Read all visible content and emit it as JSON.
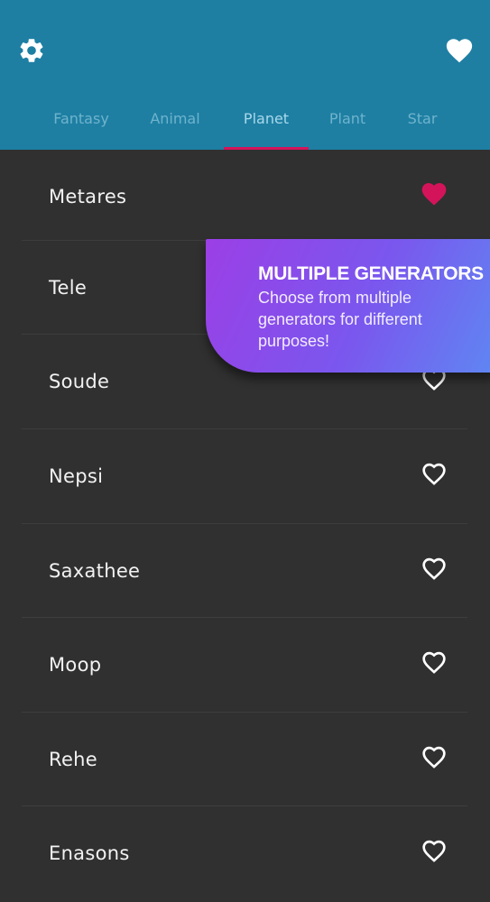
{
  "header": {
    "settings_icon": "gear-icon",
    "favorites_icon": "heart-filled-icon",
    "background_color": "#1e7fa3"
  },
  "tabs": [
    {
      "label": "Fantasy",
      "active": false
    },
    {
      "label": "Animal",
      "active": false
    },
    {
      "label": "Planet",
      "active": true
    },
    {
      "label": "Plant",
      "active": false
    },
    {
      "label": "Star",
      "active": false
    }
  ],
  "accent_color": "#d4145a",
  "names": [
    {
      "name": "Metares",
      "favorited": true
    },
    {
      "name": "Tele",
      "favorited": false
    },
    {
      "name": "Soude",
      "favorited": false
    },
    {
      "name": "Nepsi",
      "favorited": false
    },
    {
      "name": "Saxathee",
      "favorited": false
    },
    {
      "name": "Moop",
      "favorited": false
    },
    {
      "name": "Rehe",
      "favorited": false
    },
    {
      "name": "Enasons",
      "favorited": false
    }
  ],
  "tooltip": {
    "title": "MULTIPLE GENERATORS",
    "body": "Choose from multiple generators for different purposes!"
  }
}
